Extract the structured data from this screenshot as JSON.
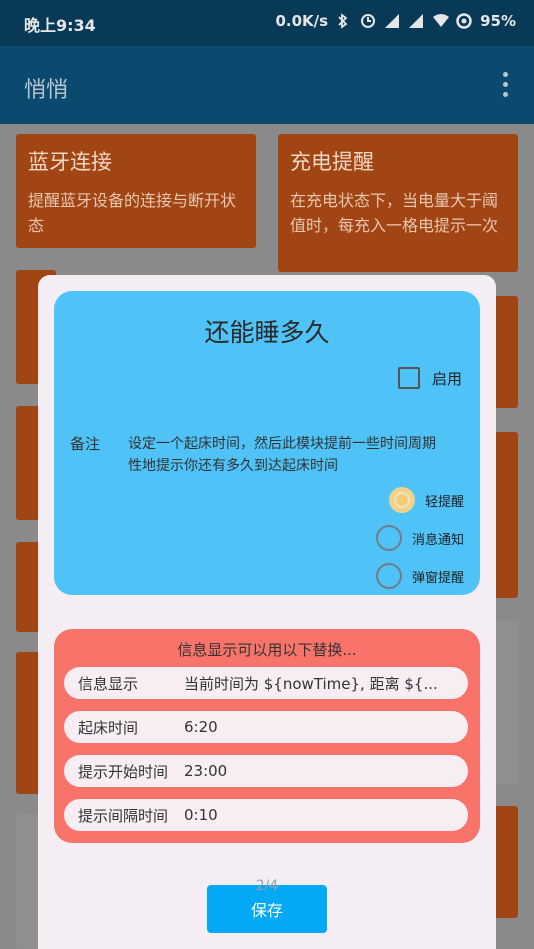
{
  "status_bar": {
    "time": "晚上9:34",
    "network": "0.0K/s",
    "battery": "95%"
  },
  "app_bar": {
    "title": "悄悄"
  },
  "tiles": [
    {
      "title": "蓝牙连接",
      "desc": "提醒蓝牙设备的连接与断开状态"
    },
    {
      "title": "充电提醒",
      "desc": "在充电状态下，当电量大于阈值时，每充入一格电提示一次"
    }
  ],
  "dialog": {
    "title": "还能睡多久",
    "enable_label": "启用",
    "note_label": "备注",
    "note_text": "设定一个起床时间，然后此模块提前一些时间周期性地提示你还有多久到达起床时间",
    "options": [
      {
        "label": "轻提醒",
        "selected": true
      },
      {
        "label": "消息通知",
        "selected": false
      },
      {
        "label": "弹窗提醒",
        "selected": false
      }
    ],
    "replace_hint": "信息显示可以用以下替换...",
    "fields": [
      {
        "label": "信息显示",
        "value": "当前时间为 ${nowTime}, 距离 ${..."
      },
      {
        "label": "起床时间",
        "value": "6:20"
      },
      {
        "label": "提示开始时间",
        "value": "23:00"
      },
      {
        "label": "提示间隔时间",
        "value": "0:10"
      }
    ],
    "page_indicator": "2/4",
    "save_label": "保存"
  }
}
